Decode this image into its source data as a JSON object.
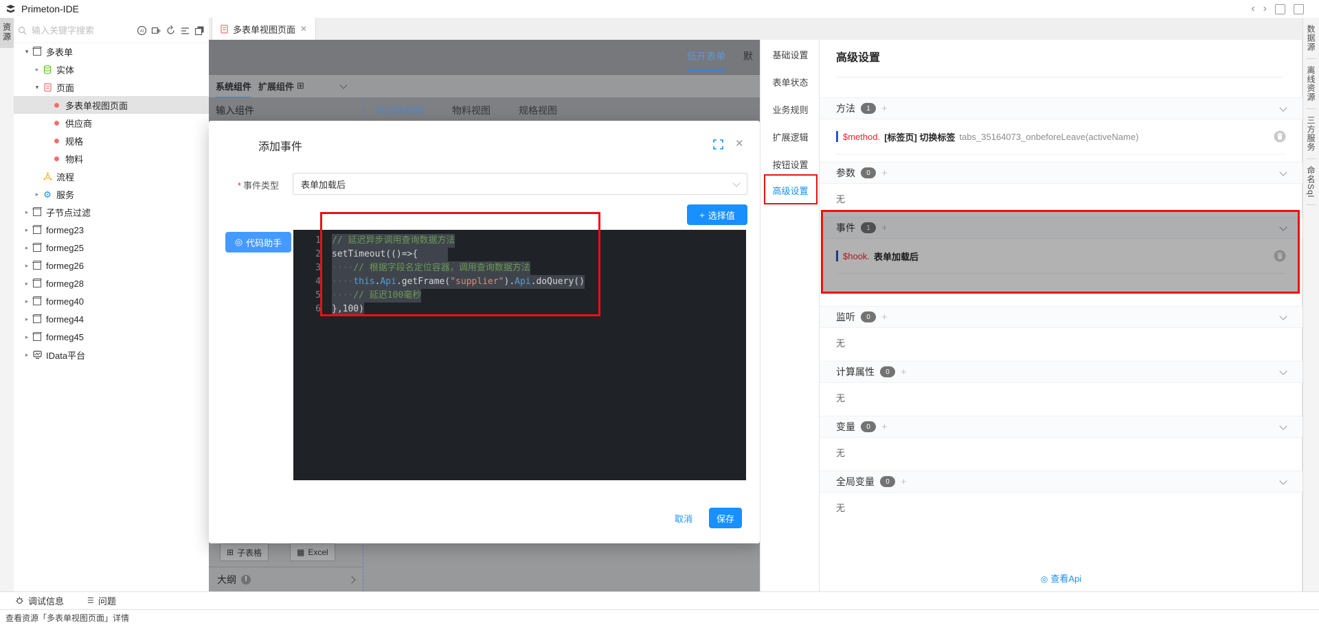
{
  "titlebar": {
    "title": "Primeton-IDE"
  },
  "activity": {
    "resources": "资源"
  },
  "sidebar": {
    "search_placeholder": "输入关键字搜索",
    "tree": [
      {
        "label": "多表单"
      },
      {
        "label": "实体"
      },
      {
        "label": "页面"
      },
      {
        "label": "多表单视图页面"
      },
      {
        "label": "供应商"
      },
      {
        "label": "规格"
      },
      {
        "label": "物料"
      },
      {
        "label": "流程"
      },
      {
        "label": "服务"
      },
      {
        "label": "子节点过滤"
      },
      {
        "label": "formeg23"
      },
      {
        "label": "formeg25"
      },
      {
        "label": "formeg26"
      },
      {
        "label": "formeg28"
      },
      {
        "label": "formeg40"
      },
      {
        "label": "formeg44"
      },
      {
        "label": "formeg45"
      },
      {
        "label": "IData平台"
      }
    ]
  },
  "tabbar": {
    "active_tab": "多表单视图页面"
  },
  "canvas": {
    "form_tab": "低开表单",
    "form_tab2": "默",
    "component_tab1": "系统组件",
    "component_tab2": "扩展组件",
    "panel_header": "输入组件",
    "view_tabs": [
      "供应商视图",
      "物料视图",
      "规格视图"
    ],
    "subtable_button": "子表格",
    "excel_button": "Excel",
    "outline_label": "大纲"
  },
  "modal": {
    "title": "添加事件",
    "event_type_label": "事件类型",
    "event_type_value": "表单加载后",
    "code_assistant": "代码助手",
    "select_value": "选择值",
    "cancel": "取消",
    "save": "保存",
    "code": [
      {
        "n": "1",
        "segs": [
          {
            "t": "// 延迟异步调用查询数据方法"
          }
        ]
      },
      {
        "n": "2",
        "segs": [
          {
            "t": "setTimeout(()=>{"
          }
        ]
      },
      {
        "n": "3",
        "segs": [
          {
            "t": "····"
          },
          {
            "t": "// 根据字段名定位容器，调用查询数据方法"
          }
        ]
      },
      {
        "n": "4",
        "segs": [
          {
            "t": "····"
          },
          {
            "t": "this"
          },
          {
            "t": "."
          },
          {
            "t": "Api"
          },
          {
            "t": ".getFrame("
          },
          {
            "t": "\"supplier\""
          },
          {
            "t": ")."
          },
          {
            "t": "Api"
          },
          {
            "t": ".doQuery()"
          }
        ]
      },
      {
        "n": "5",
        "segs": [
          {
            "t": "····"
          },
          {
            "t": "// 延迟100毫秒"
          }
        ]
      },
      {
        "n": "6",
        "segs": [
          {
            "t": "},100)"
          }
        ]
      }
    ]
  },
  "settings_menu": {
    "items": [
      "基础设置",
      "表单状态",
      "业务规则",
      "扩展逻辑",
      "按钮设置",
      "高级设置"
    ]
  },
  "panel": {
    "title": "高级设置",
    "sections": [
      {
        "label": "方法",
        "count": "1"
      },
      {
        "label": "参数",
        "count": "0"
      },
      {
        "label": "事件",
        "count": "1"
      },
      {
        "label": "监听",
        "count": "0"
      },
      {
        "label": "计算属性",
        "count": "0"
      },
      {
        "label": "变量",
        "count": "0"
      },
      {
        "label": "全局变量",
        "count": "0"
      }
    ],
    "method_row": {
      "prefix": "$method.",
      "name": "[标签页] 切换标签",
      "detail": "tabs_35164073_onbeforeLeave(activeName)"
    },
    "hook_row": {
      "prefix": "$hook.",
      "name": "表单加载后"
    },
    "empty": "无",
    "view_api": "查看Api"
  },
  "right_strip": {
    "tabs": [
      "数据源",
      "离线资源",
      "三方服务",
      "命名Sql"
    ]
  },
  "statusbar": {
    "debug": "调试信息",
    "problems": "问题"
  },
  "footer": {
    "text": "查看资源「多表单视图页面」详情"
  }
}
